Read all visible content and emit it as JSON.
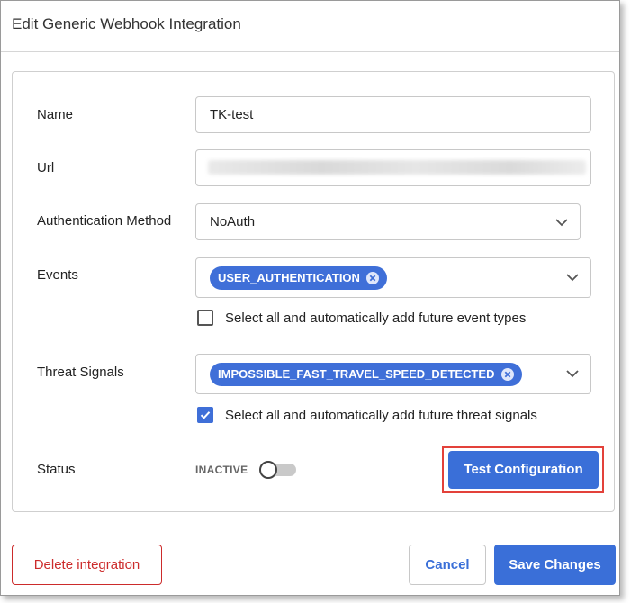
{
  "dialog": {
    "title": "Edit Generic Webhook Integration"
  },
  "form": {
    "name": {
      "label": "Name",
      "value": "TK-test"
    },
    "url": {
      "label": "Url",
      "value": ""
    },
    "auth": {
      "label": "Authentication Method",
      "value": "NoAuth"
    },
    "events": {
      "label": "Events",
      "chips": [
        "USER_AUTHENTICATION"
      ],
      "select_all_label": "Select all and automatically add future event types",
      "select_all_checked": false
    },
    "threat_signals": {
      "label": "Threat Signals",
      "chips": [
        "IMPOSSIBLE_FAST_TRAVEL_SPEED_DETECTED"
      ],
      "select_all_label": "Select all and automatically add future threat signals",
      "select_all_checked": true
    },
    "status": {
      "label": "Status",
      "toggle_text": "INACTIVE",
      "active": false
    },
    "test_button_label": "Test Configuration"
  },
  "footer": {
    "delete_label": "Delete integration",
    "cancel_label": "Cancel",
    "save_label": "Save Changes"
  },
  "colors": {
    "primary": "#3a6fd8",
    "danger": "#cc2b2b",
    "highlight": "#e3413a"
  },
  "icons": {
    "dropdown": "chevron-down-icon",
    "chip_remove": "close-circle-icon",
    "checkbox_checked": "checkmark-icon"
  }
}
